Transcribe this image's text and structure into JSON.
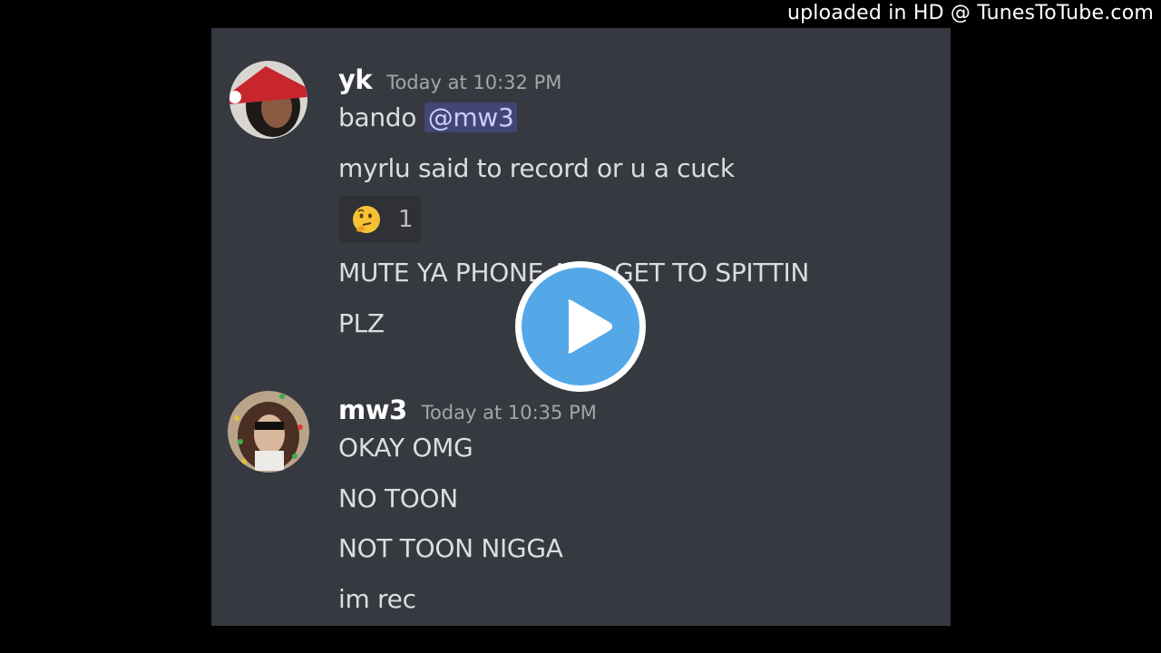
{
  "watermark": "uploaded in HD @ TunesToTube.com",
  "colors": {
    "background": "#000000",
    "panel": "#36393f",
    "username": "#ffffff",
    "timestamp": "#a3a6aa",
    "message_text": "#dcddde",
    "mention_bg": "#414675",
    "play_button": "#55a8e8"
  },
  "messages": [
    {
      "username": "yk",
      "timestamp": "Today at 10:32 PM",
      "avatar_icon": "user-avatar-santa-hat",
      "lines": [
        {
          "text": "bando ",
          "mention": "@mw3"
        },
        {
          "text": "myrlu said to record or u a cuck"
        },
        {
          "text": "MUTE YA PHONE AND GET TO SPITTIN"
        },
        {
          "text": "PLZ"
        }
      ],
      "reaction": {
        "emoji": "thinking-face-icon",
        "count": "1"
      }
    },
    {
      "username": "mw3",
      "timestamp": "Today at 10:35 PM",
      "avatar_icon": "user-avatar-christmas-lights",
      "lines": [
        {
          "text": "OKAY OMG"
        },
        {
          "text": "NO TOON"
        },
        {
          "text": "NOT TOON NIGGA"
        },
        {
          "text": "im rec"
        }
      ]
    }
  ],
  "overlay": {
    "icon": "play-icon"
  }
}
